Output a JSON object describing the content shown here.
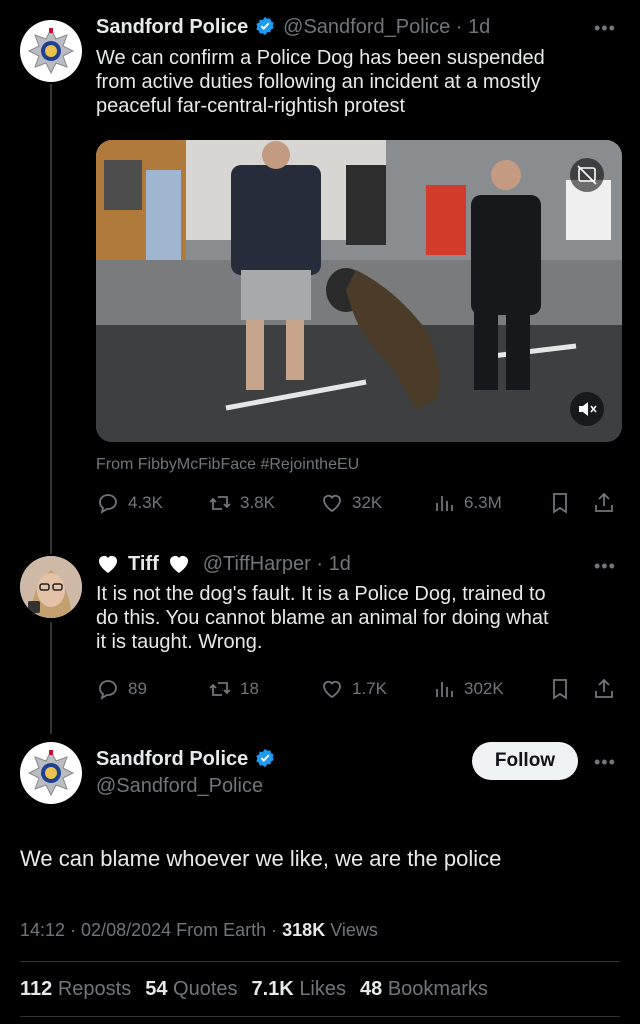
{
  "tweet1": {
    "name": "Sandford Police",
    "handle": "@Sandford_Police · 1d",
    "text_lines": [
      "We can confirm a Police Dog has been suspended",
      "from active duties following an incident at a mostly",
      "peaceful far-central-rightish protest"
    ],
    "media_source": "From FibbyMcFibFace #RejointheEU",
    "stats": {
      "replies": "4.3K",
      "reposts": "3.8K",
      "likes": "32K",
      "views": "6.3M"
    }
  },
  "tweet2": {
    "name": "Tiff",
    "handle": "@TiffHarper · 1d",
    "text_lines": [
      "It is not the dog's fault. It is a Police Dog, trained to",
      "do this. You cannot blame an animal for doing what",
      "it is taught. Wrong."
    ],
    "stats": {
      "replies": "89",
      "reposts": "18",
      "likes": "1.7K",
      "views": "302K"
    }
  },
  "main": {
    "name": "Sandford Police",
    "handle": "@Sandford_Police",
    "follow_label": "Follow",
    "text": "We can blame whoever we like, we are the police",
    "time": "14:12 · 02/08/2024 From Earth · ",
    "views_count": "318K",
    "views_label": " Views",
    "engagement": {
      "reposts_count": "112",
      "reposts_label": "Reposts",
      "quotes_count": "54",
      "quotes_label": "Quotes",
      "likes_count": "7.1K",
      "likes_label": "Likes",
      "bookmarks_count": "48",
      "bookmarks_label": "Bookmarks"
    }
  },
  "colors": {
    "background": "#000000",
    "text": "#e7e9ea",
    "secondary": "#71767b",
    "verified": "#1d9bf0"
  }
}
